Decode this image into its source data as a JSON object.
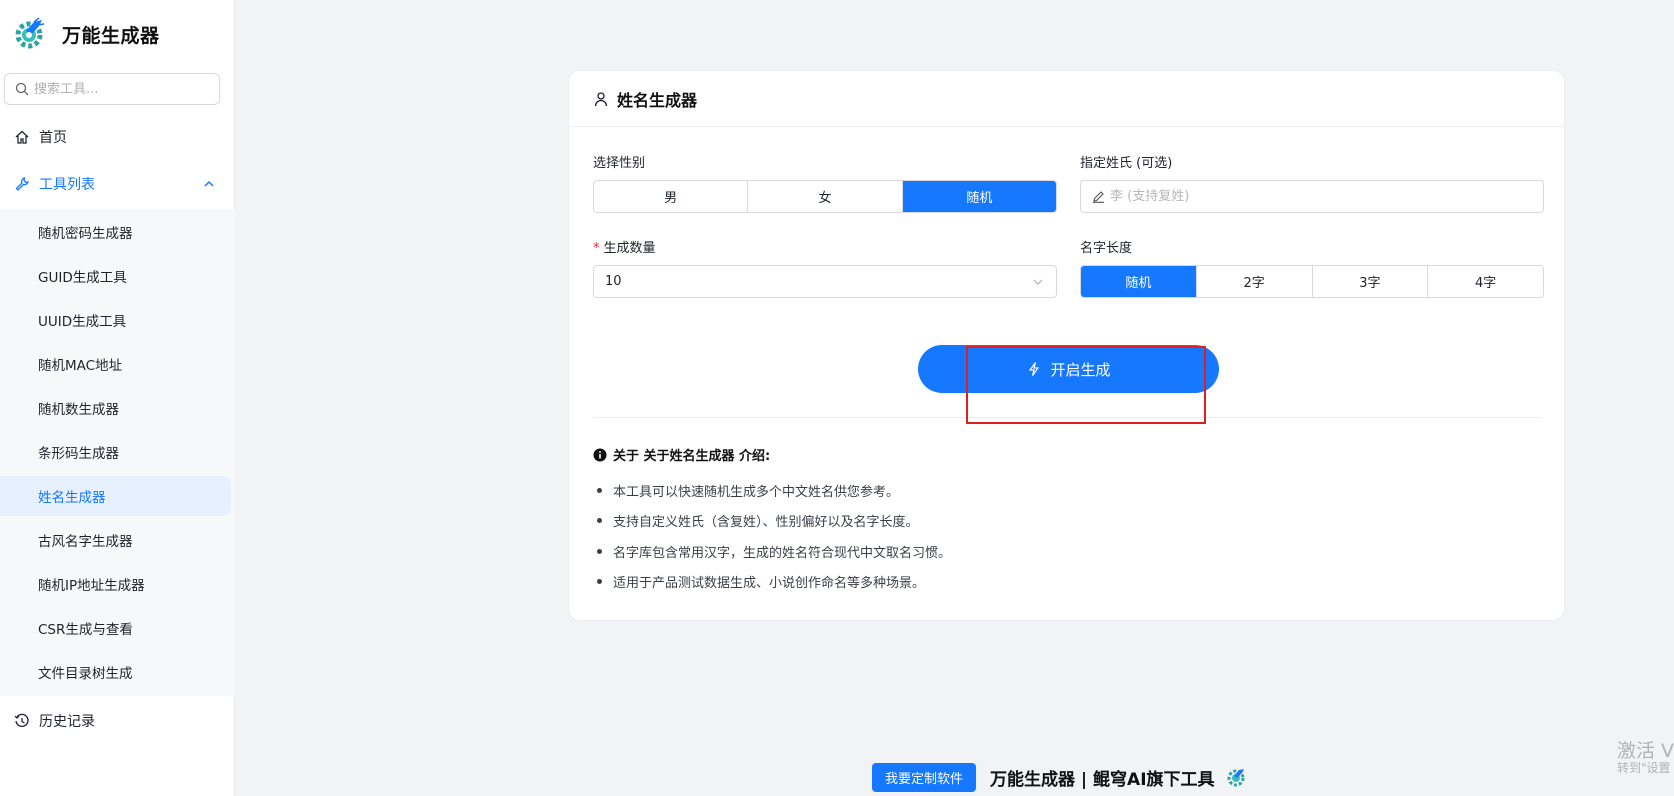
{
  "app": {
    "title": "万能生成器"
  },
  "search": {
    "placeholder": "搜索工具..."
  },
  "nav": {
    "home": "首页",
    "tools": "工具列表",
    "history": "历史记录",
    "tool_items": [
      "随机密码生成器",
      "GUID生成工具",
      "UUID生成工具",
      "随机MAC地址",
      "随机数生成器",
      "条形码生成器",
      "姓名生成器",
      "古风名字生成器",
      "随机IP地址生成器",
      "CSR生成与查看",
      "文件目录树生成"
    ],
    "selected_tool": "姓名生成器"
  },
  "card": {
    "title": "姓名生成器",
    "gender": {
      "label": "选择性别",
      "options": [
        "男",
        "女",
        "随机"
      ],
      "selected": "随机"
    },
    "surname": {
      "label": "指定姓氏 (可选)",
      "placeholder": "李 (支持复姓)"
    },
    "count": {
      "label": "生成数量",
      "value": "10"
    },
    "length": {
      "label": "名字长度",
      "options": [
        "随机",
        "2字",
        "3字",
        "4字"
      ],
      "selected": "随机"
    },
    "generate_label": "开启生成",
    "about": {
      "title": "关于 关于姓名生成器 介绍:",
      "items": [
        "本工具可以快速随机生成多个中文姓名供您参考。",
        "支持自定义姓氏（含复姓）、性别偏好以及名字长度。",
        "名字库包含常用汉字，生成的姓名符合现代中文取名习惯。",
        "适用于产品测试数据生成、小说创作命名等多种场景。"
      ]
    }
  },
  "footer": {
    "cta": "我要定制软件",
    "brand": "万能生成器 | 鲲穹AI旗下工具"
  },
  "watermark": {
    "line1": "激活 V",
    "line2": "转到\"设置"
  },
  "colors": {
    "accent": "#1677ff",
    "highlight_box": "#e02020",
    "sidebar_selected_bg": "#e6f0ff"
  },
  "icons": {
    "logo": "gear-logo-icon",
    "search": "search-icon",
    "home": "home-icon",
    "tools": "wrench-icon",
    "history": "history-icon",
    "card_title": "user-icon",
    "surname": "pencil-icon",
    "select": "chevron-down-icon",
    "generate": "lightning-icon",
    "about": "info-icon"
  }
}
